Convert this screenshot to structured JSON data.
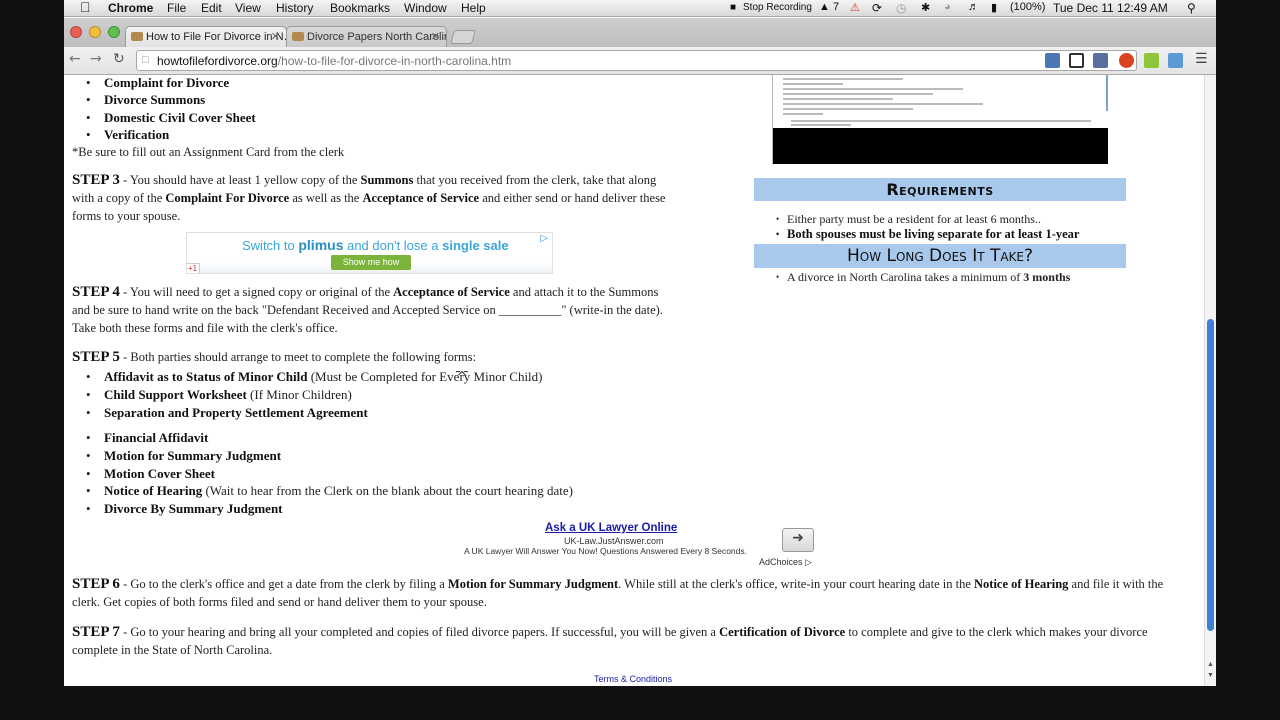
{
  "menubar": {
    "app": "Chrome",
    "items": [
      "File",
      "Edit",
      "View",
      "History",
      "Bookmarks",
      "Window",
      "Help"
    ],
    "stop_recording": "Stop Recording",
    "adobe_count": "7",
    "battery": "(100%)",
    "clock": "Tue Dec 11  12:49 AM"
  },
  "tabs": [
    {
      "title": "How to File For Divorce in N…"
    },
    {
      "title": "Divorce Papers North Carolin…"
    }
  ],
  "address": {
    "domain": "howtofilefordivorce.org",
    "path": "/how-to-file-for-divorce-in-north-carolina.htm"
  },
  "forms_top": [
    "Complaint for Divorce",
    "Divorce Summons",
    "Domestic Civil Cover Sheet",
    "Verification"
  ],
  "assignment_note": "*Be sure to fill out an Assignment Card from the clerk",
  "step3": {
    "label": "STEP 3",
    "t1": " - You should have at least 1 yellow copy of the ",
    "b1": "Summons",
    "t2": " that you received from the clerk, take that along with a copy of the ",
    "b2": "Complaint For Divorce",
    "t3": " as well as the ",
    "b3": "Acceptance of Service",
    "t4": " and either send or hand deliver these forms to your spouse."
  },
  "ad1": {
    "text_a": "Switch to ",
    "brand": "plimus",
    "text_b": " and don't lose a ",
    "text_c": "single sale",
    "button": "Show me how",
    "gplus": "+1"
  },
  "step4": {
    "label": "STEP 4",
    "t1": " - You will need to get a signed copy or original of the ",
    "b1": "Acceptance of Service",
    "t2": " and attach it to the Summons and be sure to hand write on the back \"Defendant Received and Accepted Service on __________\" (write-in the date). Take both these forms and file with the clerk's office."
  },
  "step5": {
    "label": "STEP 5",
    "t1": " - Both parties should arrange to meet to complete the following forms:"
  },
  "step5_forms": [
    {
      "name": "Affidavit as to Status of Minor Child",
      "note": " (Must be Completed for Every Minor Child)"
    },
    {
      "name": "Child Support Worksheet",
      "note": " (If Minor Children)"
    },
    {
      "name": "Separation and Property Settlement Agreement",
      "note": ""
    },
    {
      "name": "Financial Affidavit",
      "note": ""
    },
    {
      "name": "Motion for Summary Judgment",
      "note": ""
    },
    {
      "name": "Motion Cover Sheet",
      "note": ""
    },
    {
      "name": "Notice of Hearing",
      "note": " (Wait to hear from the Clerk on the blank about the court hearing date)"
    },
    {
      "name": "Divorce By Summary Judgment",
      "note": ""
    }
  ],
  "ad2": {
    "title": "Ask a UK Lawyer Online",
    "url": "UK-Law.JustAnswer.com",
    "desc": "A UK Lawyer Will Answer You Now! Questions Answered Every 8 Seconds.",
    "adchoices": "AdChoices"
  },
  "step6": {
    "label": "STEP 6",
    "t1": " - Go to the clerk's office and get a date from the clerk by filing a ",
    "b1": "Motion for Summary Judgment",
    "t2": ". While still at the clerk's office, write-in your court hearing date in the ",
    "b2": "Notice of Hearing",
    "t3": " and file it with the clerk. Get copies of both forms filed and send or hand deliver them to your spouse."
  },
  "step7": {
    "label": "STEP 7",
    "t1": " - Go to your hearing and bring all your completed and copies of filed divorce papers. If successful, you will be given a ",
    "b1": "Certification of Divorce",
    "t2": " to complete and give to the clerk which makes your divorce complete in the State of North Carolina."
  },
  "sidebar": {
    "requirements_title": "Requirements",
    "req1": "Either party must be a resident for at least 6 months..",
    "req2": "Both spouses must be living separate for at least 1-year",
    "howlong_title": "How Long Does It Take?",
    "howlong_text": "A divorce in North Carolina takes a minimum of ",
    "howlong_bold": "3 months"
  },
  "footer": {
    "terms": "Terms & Conditions"
  }
}
